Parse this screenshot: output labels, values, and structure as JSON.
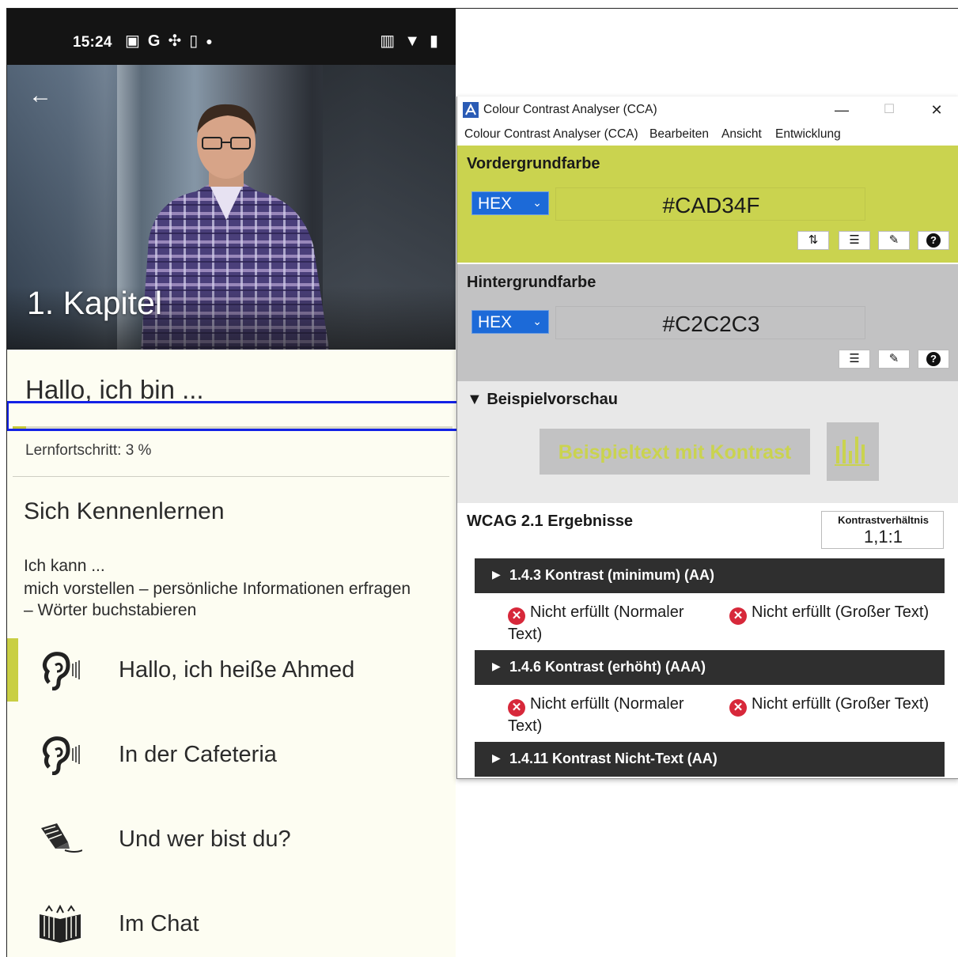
{
  "phone": {
    "status": {
      "time": "15:24"
    },
    "hero": {
      "chapter": "1. Kapitel"
    },
    "greeting": "Hallo, ich bin ...",
    "progress": {
      "label": "Lernfortschritt: 3 %",
      "value_percent": 3
    },
    "section_title": "Sich Kennenlernen",
    "goals_intro": "Ich kann ...",
    "goals_detail": "mich vorstellen – persönliche Informationen erfragen – Wörter buchstabieren",
    "lessons": [
      {
        "label": "Hallo, ich heiße Ahmed",
        "icon": "audio-icon"
      },
      {
        "label": "In der Cafeteria",
        "icon": "audio-icon"
      },
      {
        "label": "Und wer bist du?",
        "icon": "writing-icon"
      },
      {
        "label": "Im Chat",
        "icon": "reading-icon"
      }
    ]
  },
  "cca": {
    "title": "Colour Contrast Analyser (CCA)",
    "window_controls": {
      "minimize": "—",
      "maximize": "☐",
      "close": "✕"
    },
    "menu": [
      "Colour Contrast Analyser (CCA)",
      "Bearbeiten",
      "Ansicht",
      "Entwicklung"
    ],
    "foreground": {
      "title": "Vordergrundfarbe",
      "format": "HEX",
      "value": "#CAD34F",
      "color": "#cad34f"
    },
    "background": {
      "title": "Hintergrundfarbe",
      "format": "HEX",
      "value": "#C2C2C3",
      "color": "#c2c2c3"
    },
    "preview": {
      "title": "▼ Beispielvorschau",
      "text": "Beispieltext mit Kontrast"
    },
    "wcag": {
      "title": "WCAG 2.1 Ergebnisse",
      "ratio_label": "Kontrastverhältnis",
      "ratio_value": "1,1:1",
      "criteria": [
        {
          "label": "1.4.3 Kontrast (minimum) (AA)",
          "normal": "Nicht erfüllt (Normaler Text)",
          "large": "Nicht erfüllt (Großer Text)"
        },
        {
          "label": "1.4.6 Kontrast (erhöht) (AAA)",
          "normal": "Nicht erfüllt (Normaler Text)",
          "large": "Nicht erfüllt (Großer Text)"
        },
        {
          "label": "1.4.11 Kontrast Nicht-Text (AA)"
        }
      ]
    }
  },
  "colors": {
    "highlight_box": "#1322e6",
    "accent": "#c9cf44",
    "fail": "#d7283a"
  }
}
